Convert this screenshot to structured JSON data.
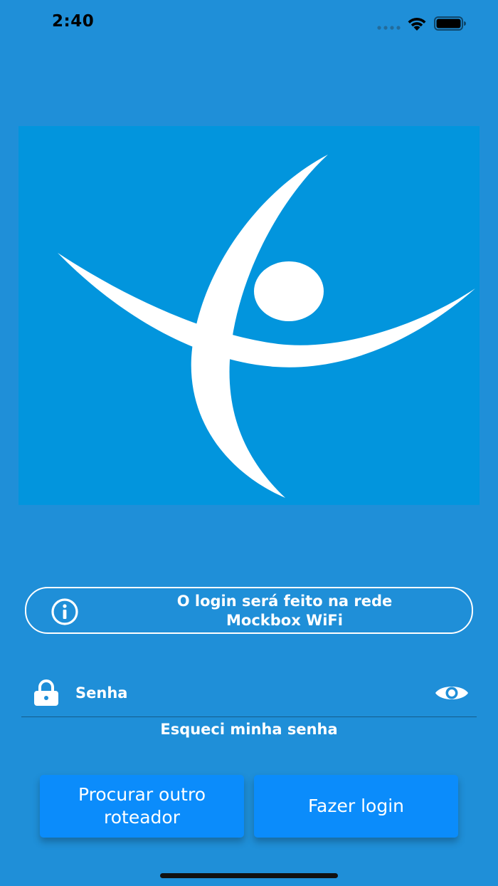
{
  "status_bar": {
    "time": "2:40",
    "signal_icon": "cellular-dots-icon",
    "wifi_icon": "wifi-icon",
    "battery_icon": "battery-icon"
  },
  "logo": {
    "icon": "brand-figure-logo",
    "background_color": "#0295dd"
  },
  "info_banner": {
    "icon": "info-circle-icon",
    "line1": "O login será feito na rede",
    "line2": "Mockbox WiFi"
  },
  "password_field": {
    "icon": "lock-icon",
    "placeholder": "Senha",
    "value": "",
    "toggle_icon": "eye-icon"
  },
  "forgot_password": {
    "label": "Esqueci minha senha"
  },
  "buttons": {
    "search_router": "Procurar outro roteador",
    "login": "Fazer login"
  },
  "colors": {
    "background": "#1f8fd8",
    "button": "#0b8cfb",
    "text": "#ffffff"
  }
}
